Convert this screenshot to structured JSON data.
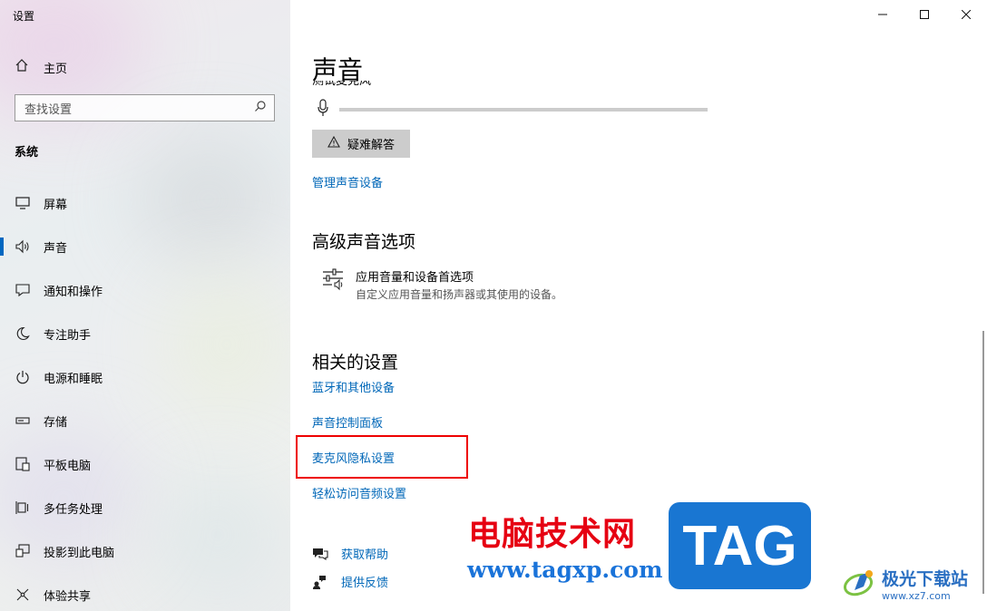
{
  "window": {
    "title": "设置"
  },
  "sidebar": {
    "home_label": "主页",
    "search": {
      "placeholder": "查找设置"
    },
    "section_label": "系统",
    "items": [
      {
        "label": "屏幕",
        "icon": "monitor-icon"
      },
      {
        "label": "声音",
        "icon": "speaker-icon",
        "active": true
      },
      {
        "label": "通知和操作",
        "icon": "notification-icon"
      },
      {
        "label": "专注助手",
        "icon": "moon-icon"
      },
      {
        "label": "电源和睡眠",
        "icon": "power-icon"
      },
      {
        "label": "存储",
        "icon": "storage-icon"
      },
      {
        "label": "平板电脑",
        "icon": "tablet-icon"
      },
      {
        "label": "多任务处理",
        "icon": "multitask-icon"
      },
      {
        "label": "投影到此电脑",
        "icon": "project-icon"
      },
      {
        "label": "体验共享",
        "icon": "share-icon"
      }
    ]
  },
  "main": {
    "page_title": "声音",
    "cut_label": "测试麦克风",
    "troubleshoot_label": "疑难解答",
    "manage_devices_link": "管理声音设备",
    "advanced": {
      "heading": "高级声音选项",
      "item_title": "应用音量和设备首选项",
      "item_desc": "自定义应用音量和扬声器或其使用的设备。"
    },
    "related": {
      "heading": "相关的设置",
      "links": [
        "蓝牙和其他设备",
        "声音控制面板",
        "麦克风隐私设置",
        "轻松访问音频设置"
      ]
    },
    "help": {
      "get_help": "获取帮助",
      "feedback": "提供反馈"
    }
  },
  "watermark": {
    "cn": "电脑技术网",
    "url": "www.tagxp.com",
    "tag": "TAG",
    "site_name": "极光下载站",
    "site_url": "www.xz7.com"
  },
  "colors": {
    "accent": "#0067b8",
    "highlight_box": "#e00000",
    "active_bar": "#0067c0"
  }
}
